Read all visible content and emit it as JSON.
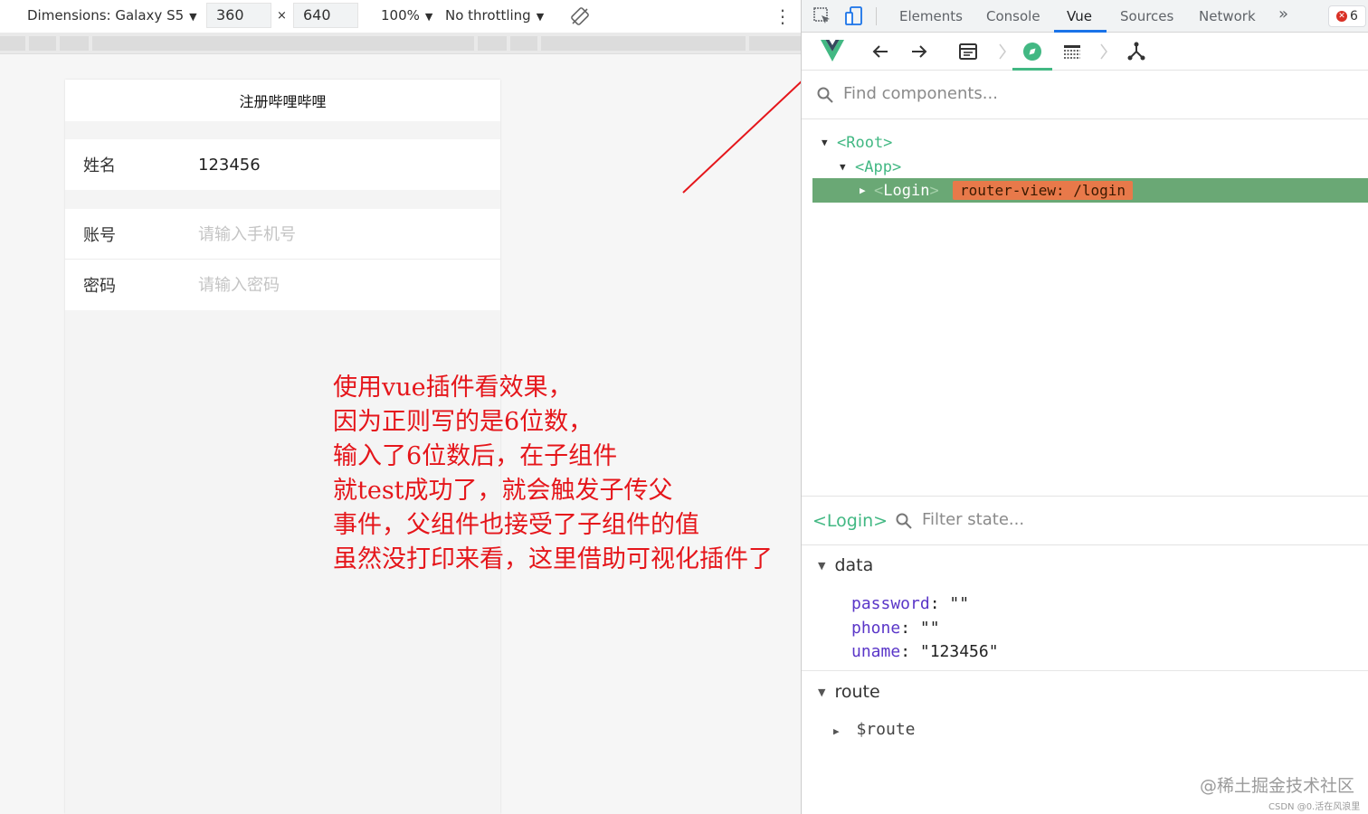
{
  "device_toolbar": {
    "dimensions_label": "Dimensions: Galaxy S5",
    "width_value": "360",
    "times_sign": "×",
    "height_value": "640",
    "zoom_label": "100%",
    "throttling_label": "No throttling",
    "caret": "▼",
    "more_icon": "⋮"
  },
  "phone": {
    "title": "注册哔哩哔哩",
    "rows": [
      {
        "label": "姓名",
        "value": "123456",
        "placeholder": ""
      },
      {
        "label": "账号",
        "value": "",
        "placeholder": "请输入手机号"
      },
      {
        "label": "密码",
        "value": "",
        "placeholder": "请输入密码"
      }
    ]
  },
  "annotation": {
    "lines": [
      "使用vue插件看效果，",
      "因为正则写的是6位数，",
      "输入了6位数后，在子组件",
      "就test成功了，就会触发子传父",
      "事件，父组件也接受了子组件的值",
      "虽然没打印来看，这里借助可视化插件了"
    ],
    "color": "#e5161b"
  },
  "devtools": {
    "tabs": [
      {
        "label": "Elements"
      },
      {
        "label": "Console"
      },
      {
        "label": "Vue"
      },
      {
        "label": "Sources"
      },
      {
        "label": "Network"
      }
    ],
    "more_tabs": "»",
    "error_count": "6",
    "error_mark": "✕",
    "find_placeholder": "Find components...",
    "tree": {
      "root": "<Root>",
      "app": "<App>",
      "selected_open": "<",
      "selected_name": "Login",
      "selected_close": ">",
      "route_badge": "router-view: /login"
    },
    "state_component": "<Login>",
    "filter_placeholder": "Filter state...",
    "sections": {
      "data": "data",
      "route": "route"
    },
    "data_props": [
      {
        "key": "password",
        "value": "\"\""
      },
      {
        "key": "phone",
        "value": "\"\""
      },
      {
        "key": "uname",
        "value": "\"123456\""
      }
    ],
    "route_props": [
      {
        "key": "$route"
      }
    ],
    "triangle_open": "▼",
    "triangle_closed": "▶",
    "colon": ":",
    "accent_color": "#42b883",
    "selected_row_color": "#6aa875",
    "badge_color": "#e8794a"
  },
  "watermark": "@稀土掘金技术社区",
  "credit": "CSDN @0.活在风浪里"
}
